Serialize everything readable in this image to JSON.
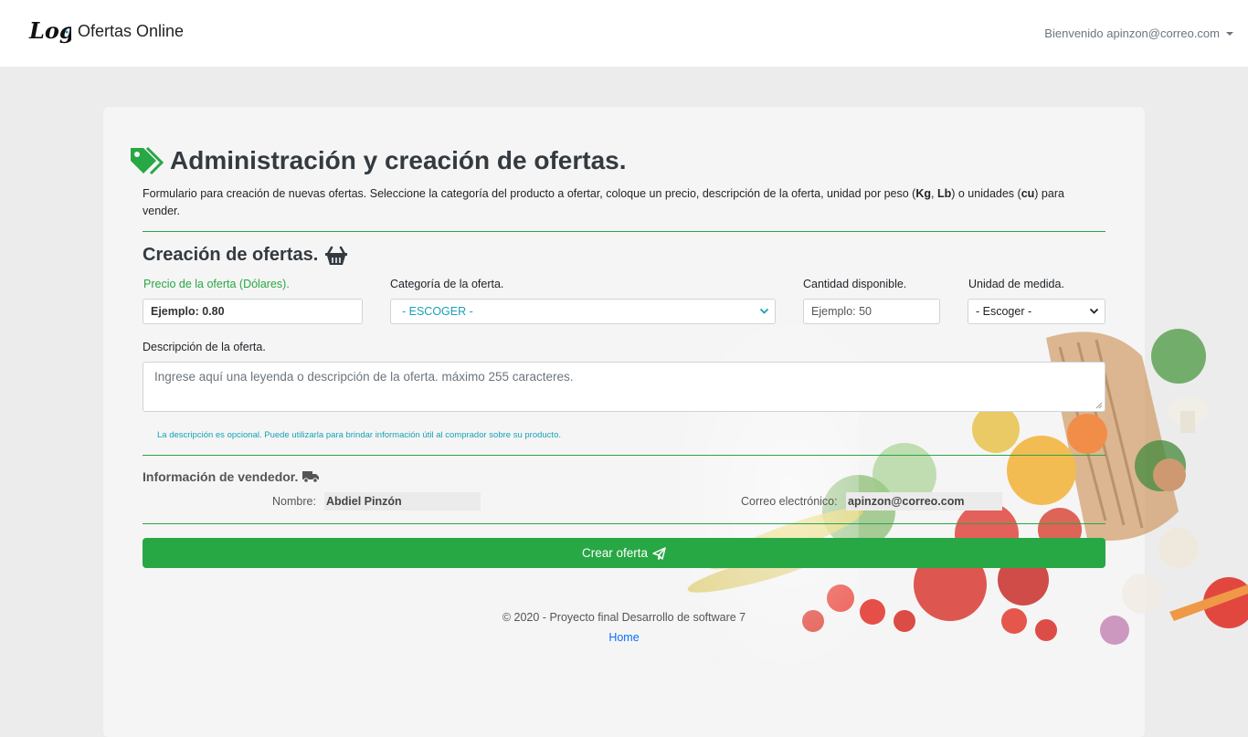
{
  "navbar": {
    "logo_text": "Logo",
    "brand": "Ofertas Online",
    "user_greeting": "Bienvenido apinzon@correo.com"
  },
  "header": {
    "title": "Administración y creación de ofertas.",
    "intro_part1": "Formulario para creación de nuevas ofertas. Seleccione la categoría del producto a ofertar, coloque un precio, descripción de la oferta, unidad por peso (",
    "kg": "Kg",
    "comma": ", ",
    "lb": "Lb",
    "intro_part2": ") o unidades (",
    "cu": "cu",
    "intro_part3": ") para vender."
  },
  "form": {
    "section_title": "Creación de ofertas.",
    "price_label": "Precio de la oferta (Dólares).",
    "price_placeholder": "Ejemplo: 0.80",
    "category_label": "Categoría de la oferta.",
    "category_selected": "- ESCOGER -",
    "quantity_label": "Cantidad disponible.",
    "quantity_placeholder": "Ejemplo: 50",
    "unit_label": "Unidad de medida.",
    "unit_selected": "- Escoger -",
    "description_label": "Descripción de la oferta.",
    "description_placeholder": "Ingrese aquí una leyenda o descripción de la oferta. máximo 255 caracteres.",
    "description_hint": "La descripción es opcional. Puede utilizarla para brindar información útil al comprador sobre su producto."
  },
  "vendor": {
    "title": "Información de vendedor.",
    "name_label": "Nombre:",
    "name_value": "Abdiel Pinzón",
    "email_label": "Correo electrónico:",
    "email_value": "apinzon@correo.com"
  },
  "actions": {
    "create_label": "Crear oferta"
  },
  "footer": {
    "copyright": "© 2020 - Proyecto final Desarrollo de software 7",
    "home_link": "Home"
  },
  "colors": {
    "accent_green": "#28a745",
    "teal": "#17a2b8",
    "link_blue": "#0d6efd"
  }
}
